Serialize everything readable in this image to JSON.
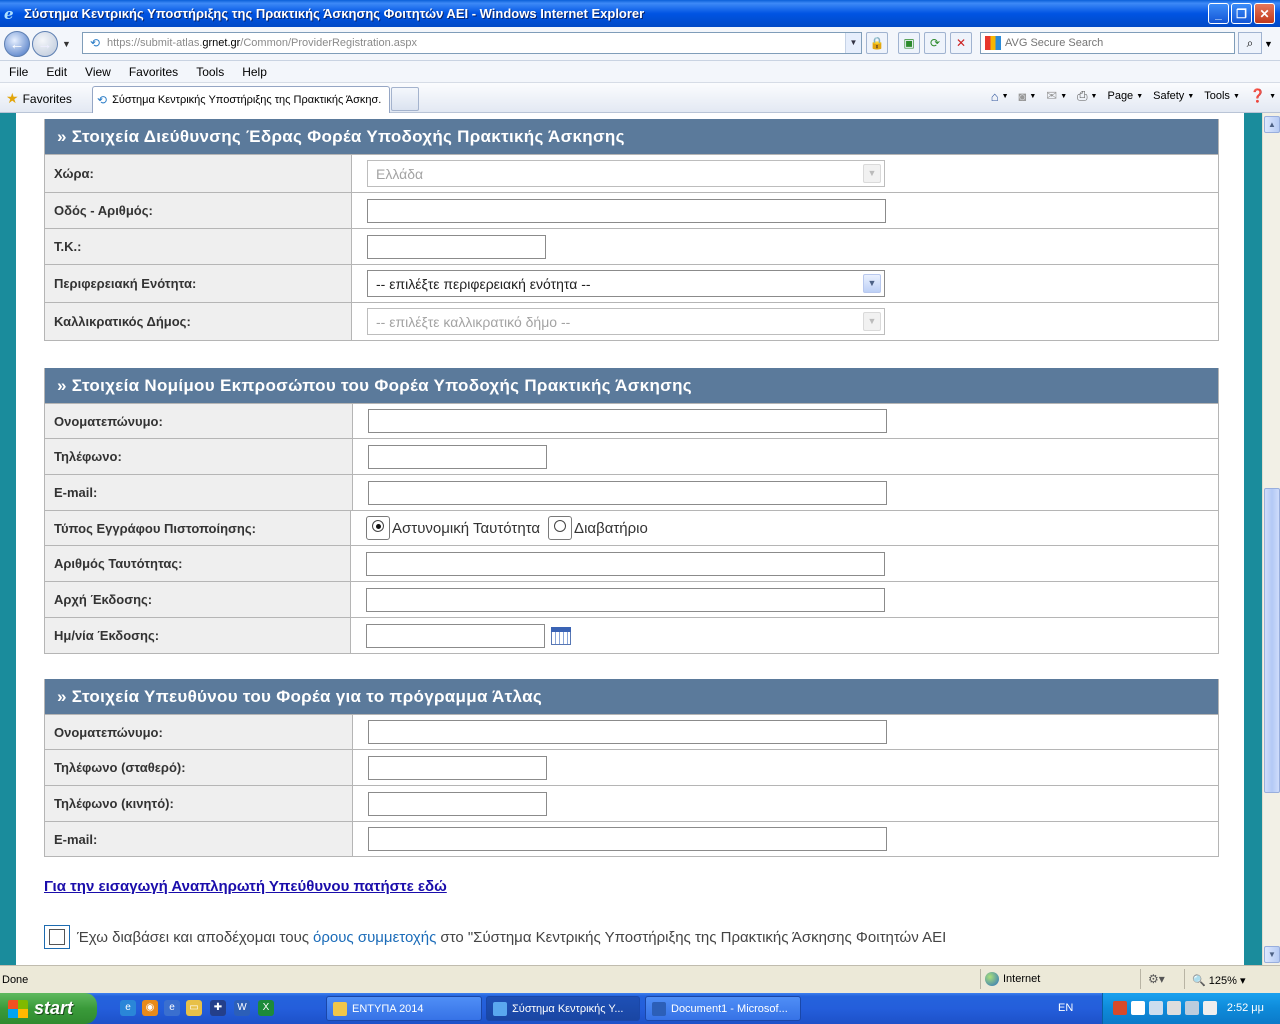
{
  "window": {
    "title": "Σύστημα Κεντρικής Υποστήριξης της Πρακτικής Άσκησης Φοιτητών ΑΕΙ - Windows Internet Explorer"
  },
  "address": {
    "url_prefix": "https://submit-atlas.",
    "url_domain": "grnet.gr",
    "url_path": "/Common/ProviderRegistration.aspx",
    "search_placeholder": "AVG Secure Search"
  },
  "menu": [
    "File",
    "Edit",
    "View",
    "Favorites",
    "Tools",
    "Help"
  ],
  "favbar": {
    "favorites_label": "Favorites",
    "tab_title": "Σύστημα Κεντρικής Υποστήριξης της Πρακτικής Άσκησ...",
    "commands": [
      "Page",
      "Safety",
      "Tools"
    ]
  },
  "sections": {
    "address": {
      "title": "» Στοιχεία Διεύθυνσης Έδρας Φορέα Υποδοχής Πρακτικής Άσκησης",
      "country_label": "Χώρα:",
      "country_value": "Ελλάδα",
      "street_label": "Οδός - Αριθμός:",
      "zip_label": "Τ.Κ.:",
      "region_label": "Περιφερειακή Ενότητα:",
      "region_value": "-- επιλέξτε περιφερειακή ενότητα --",
      "municipality_label": "Καλλικρατικός Δήμος:",
      "municipality_value": "-- επιλέξτε καλλικρατικό δήμο --"
    },
    "legal_rep": {
      "title": "» Στοιχεία Νομίμου Εκπροσώπου του Φορέα Υποδοχής Πρακτικής Άσκησης",
      "name_label": "Ονοματεπώνυμο:",
      "phone_label": "Τηλέφωνο:",
      "email_label": "E-mail:",
      "doctype_label": "Τύπος Εγγράφου Πιστοποίησης:",
      "doctype_option1": "Αστυνομική Ταυτότητα",
      "doctype_option2": "Διαβατήριο",
      "idnum_label": "Αριθμός Ταυτότητας:",
      "authority_label": "Αρχή Έκδοσης:",
      "issue_date_label": "Ημ/νία Έκδοσης:"
    },
    "responsible": {
      "title": "» Στοιχεία Υπευθύνου του Φορέα για το πρόγραμμα Άτλας",
      "name_label": "Ονοματεπώνυμο:",
      "phone_fixed_label": "Τηλέφωνο (σταθερό):",
      "phone_mobile_label": "Τηλέφωνο (κινητό):",
      "email_label": "E-mail:"
    }
  },
  "alt_link": "Για την εισαγωγή Αναπληρωτή Υπεύθυνου πατήστε εδώ",
  "terms": {
    "prefix": "Έχω διαβάσει και αποδέχομαι τους",
    "link": "όρους συμμετοχής",
    "suffix": "στο \"Σύστημα Κεντρικής Υποστήριξης της Πρακτικής Άσκησης Φοιτητών ΑΕΙ"
  },
  "status": {
    "text": "Done",
    "zone": "Internet",
    "zoom": "125%"
  },
  "taskbar": {
    "start": "start",
    "tasks": [
      "ΕΝΤΥΠΑ 2014",
      "Σύστημα Κεντρικής Υ...",
      "Document1 - Microsof..."
    ],
    "lang": "EN",
    "clock": "2:52 μμ"
  }
}
